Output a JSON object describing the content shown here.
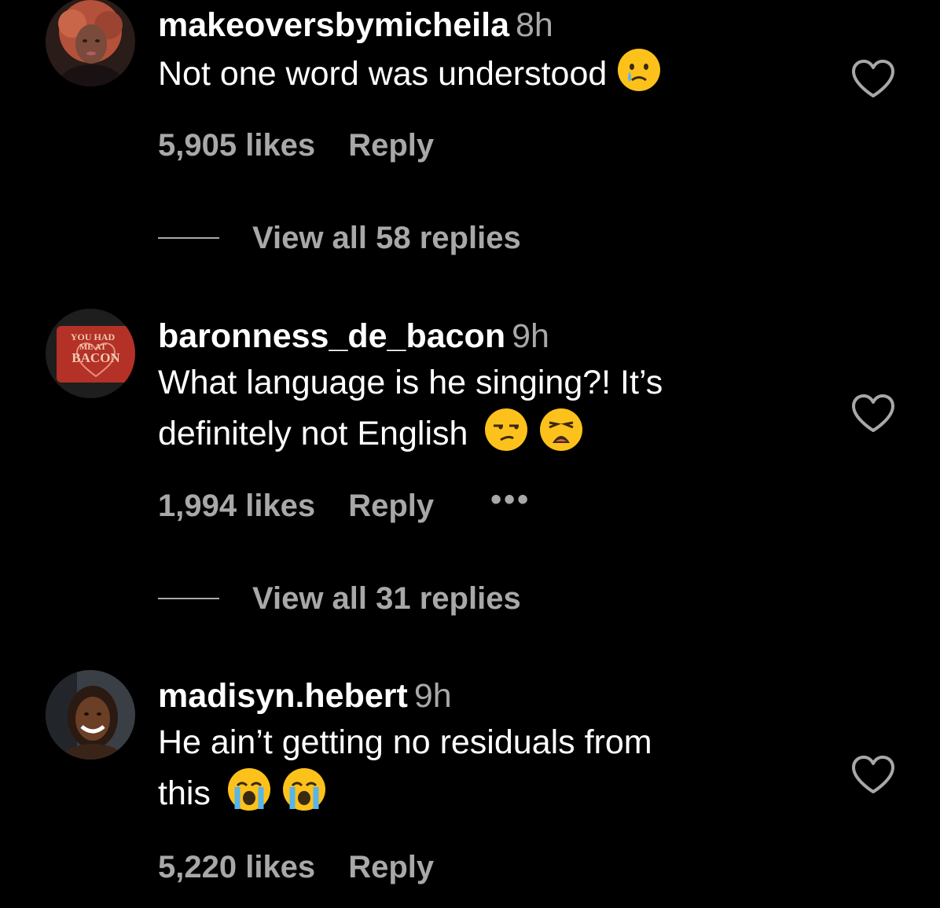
{
  "comments": [
    {
      "username": "makeoversbymicheila",
      "time": "8h",
      "text": "Not one word was understood",
      "emojis": [
        "crying-face-emoji"
      ],
      "likes": "5,905 likes",
      "reply_label": "Reply",
      "view_replies": "View all 58 replies"
    },
    {
      "username": "baronness_de_bacon",
      "time": "9h",
      "text_line1": "What language is he singing?! It’s",
      "text_line2": "definitely not English",
      "emojis": [
        "unamused-face-emoji",
        "weary-face-emoji"
      ],
      "likes": "1,994 likes",
      "reply_label": "Reply",
      "more_label": "•••",
      "view_replies": "View all 31 replies",
      "avatar_text": [
        "YOU HAD",
        "ME AT",
        "BACON"
      ]
    },
    {
      "username": "madisyn.hebert",
      "time": "9h",
      "text_line1": "He ain’t getting no residuals from",
      "text_line2": "this",
      "emojis": [
        "loudly-crying-face-emoji",
        "loudly-crying-face-emoji"
      ],
      "likes": "5,220 likes",
      "reply_label": "Reply"
    }
  ],
  "colors": {
    "background": "#000000",
    "primary_text": "#ffffff",
    "secondary_text": "#a8a8a8"
  }
}
